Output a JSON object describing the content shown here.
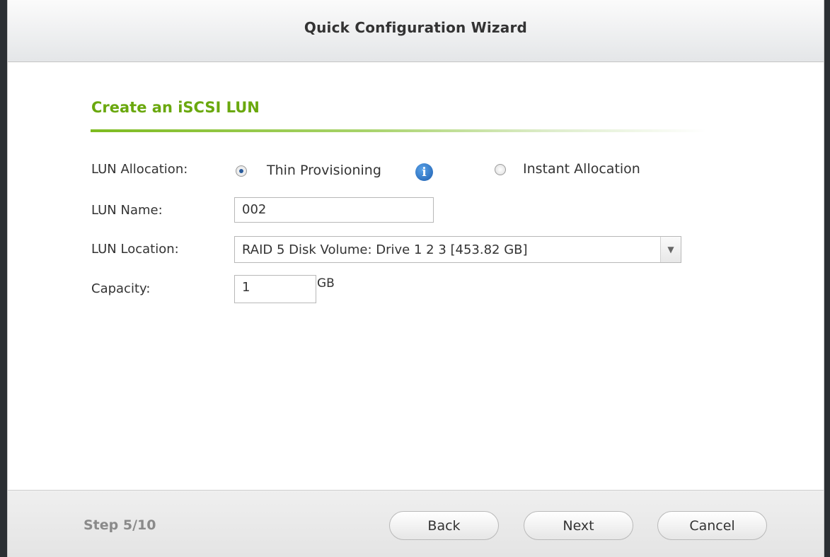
{
  "window": {
    "title": "Quick Configuration Wizard"
  },
  "section": {
    "title": "Create an iSCSI LUN"
  },
  "form": {
    "allocation": {
      "label": "LUN Allocation:",
      "options": [
        {
          "label": "Thin Provisioning",
          "selected": true
        },
        {
          "label": "Instant Allocation",
          "selected": false
        }
      ],
      "info_icon": "info-icon"
    },
    "name": {
      "label": "LUN Name:",
      "value": "002"
    },
    "location": {
      "label": "LUN Location:",
      "value": "RAID 5 Disk Volume: Drive  1 2 3 [453.82 GB]"
    },
    "capacity": {
      "label": "Capacity:",
      "value": "1",
      "unit": "GB"
    }
  },
  "footer": {
    "step": "Step 5/10",
    "back_label": "Back",
    "next_label": "Next",
    "cancel_label": "Cancel"
  },
  "colors": {
    "accent": "#6aa80e",
    "info": "#1d5fb0"
  }
}
